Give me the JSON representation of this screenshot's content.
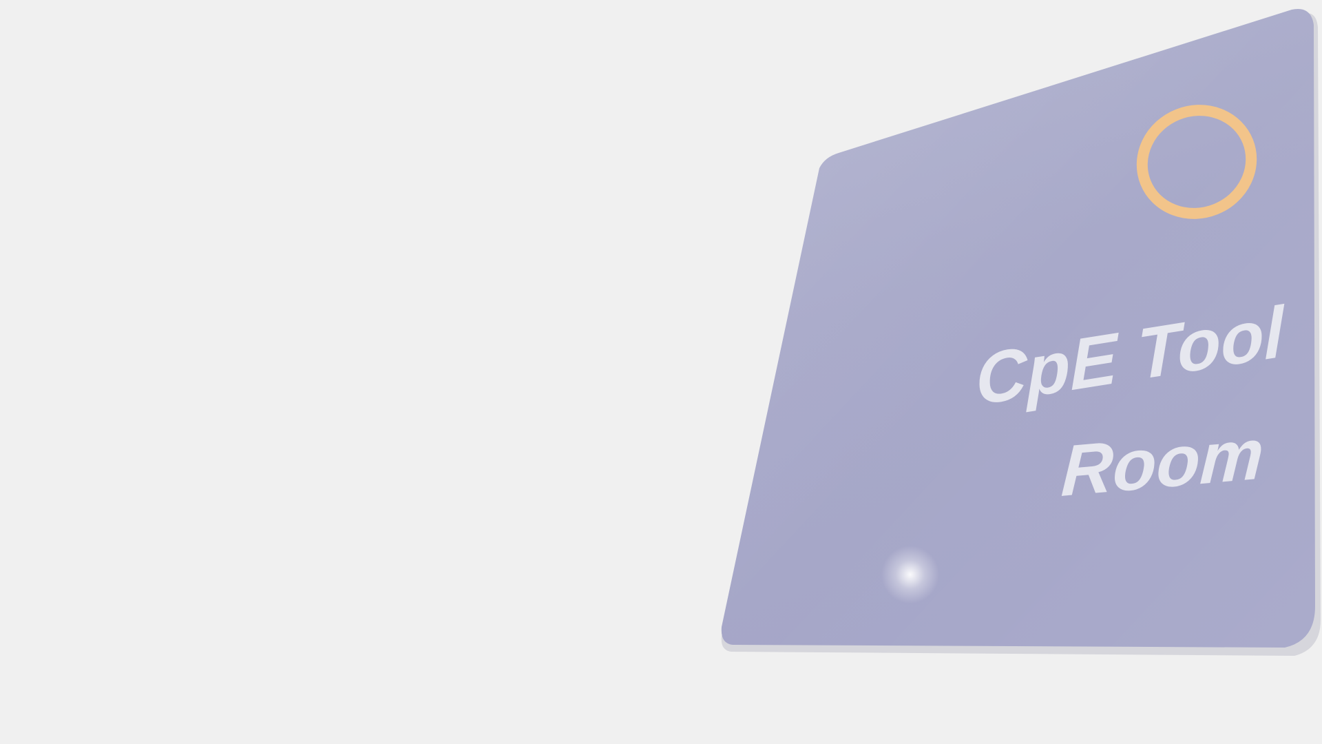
{
  "sign": {
    "line1": "CpE Tool",
    "line2": "Room",
    "colors": {
      "background": "#f0f0f0",
      "panel": "#a9aac9",
      "panel_shadow": "#d8d8dc",
      "text": "#e6e7ef",
      "ring": "#f2c48a"
    },
    "icon": "ring-icon"
  }
}
